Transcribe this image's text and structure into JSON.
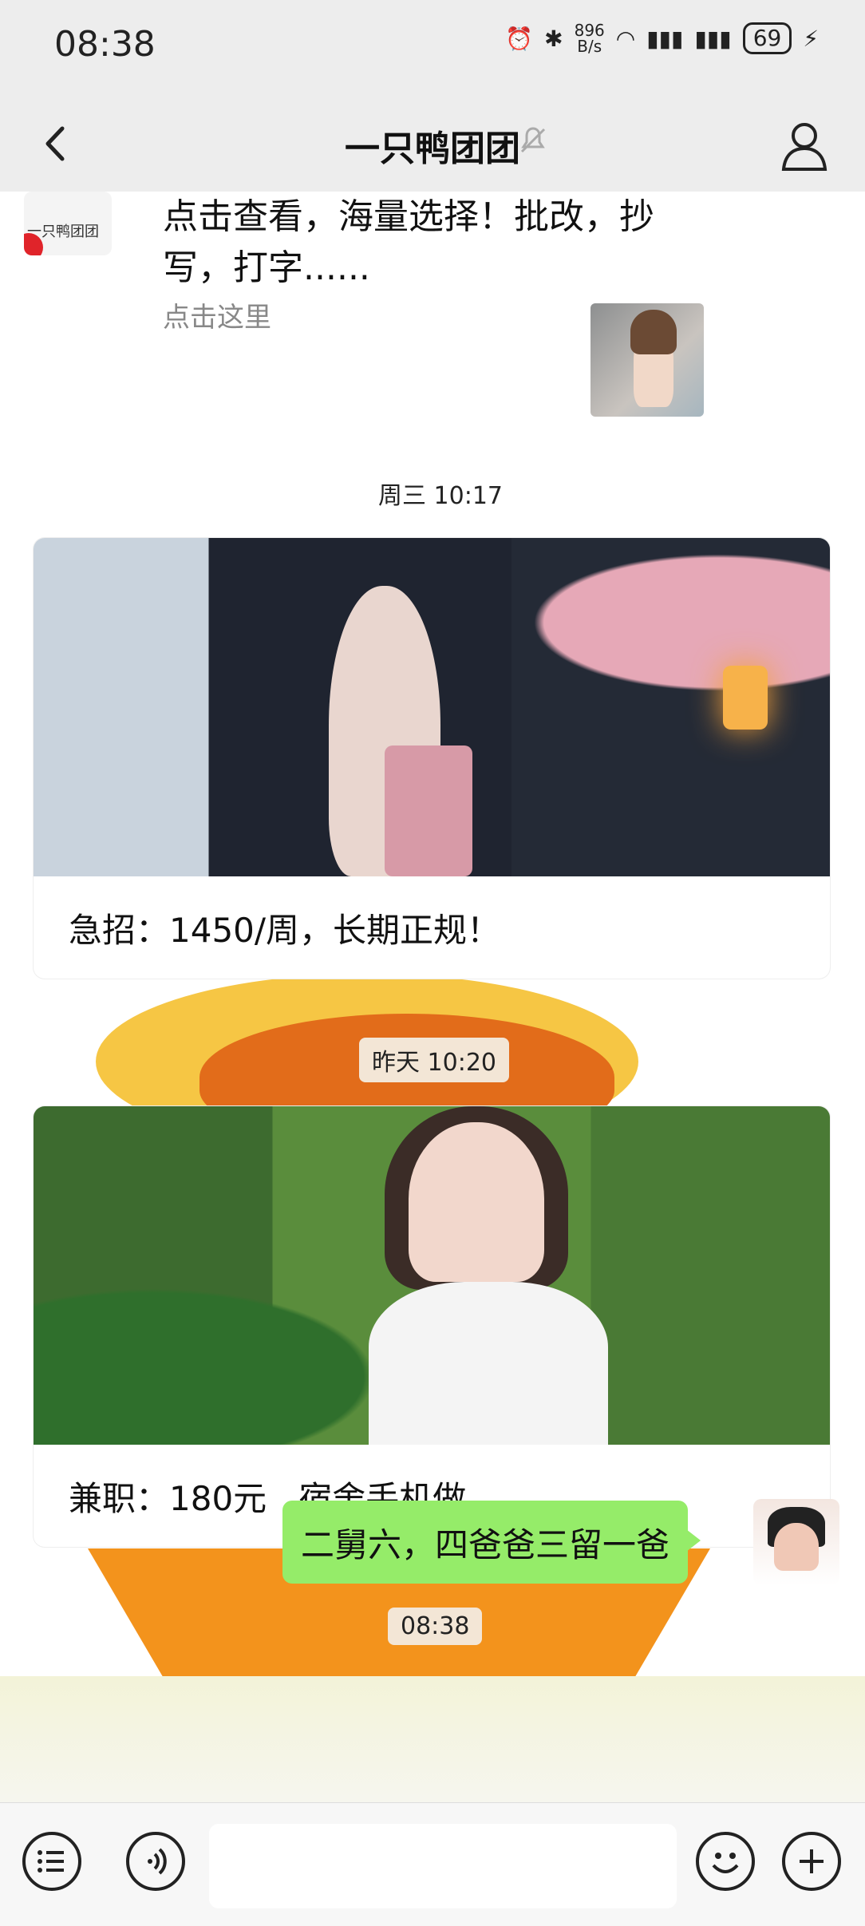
{
  "status_bar": {
    "time": "08:38",
    "net_speed": "896\nB/s",
    "battery": "69"
  },
  "header": {
    "title": "一只鸭团团"
  },
  "messages": {
    "top": {
      "avatar_label": "一只鸭团团",
      "text": "点击查看，海量选择！批改，抄写，打字......",
      "sub": "点击这里"
    },
    "time1": "周三 10:17",
    "card1": {
      "caption": "急招：1450/周，长期正规！"
    },
    "time2": "昨天 10:20",
    "card2": {
      "caption": "兼职：180元   宿舍手机做"
    },
    "time3": "08:38",
    "outgoing": {
      "text": "二舅六，四爸爸三留一爸"
    }
  },
  "colors": {
    "bubble_out": "#95ec69",
    "badge_bg": "#f3e6d6"
  }
}
